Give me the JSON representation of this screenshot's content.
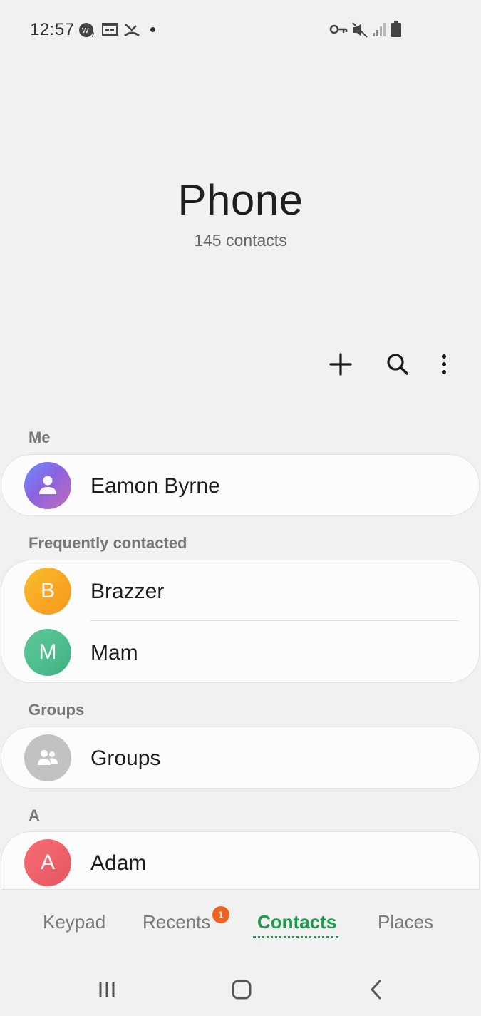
{
  "status_bar": {
    "time": "12:57"
  },
  "header": {
    "title": "Phone",
    "subtitle": "145 contacts"
  },
  "actions": {
    "add_icon": "plus-icon",
    "search_icon": "search-icon",
    "more_icon": "more-vert-icon"
  },
  "sections": {
    "me_label": "Me",
    "me_contact": {
      "name": "Eamon Byrne"
    },
    "frequent_label": "Frequently contacted",
    "frequent_contacts": [
      {
        "initial": "B",
        "name": "Brazzer",
        "color": "#f9a825"
      },
      {
        "initial": "M",
        "name": "Mam",
        "color": "#4fbf8f"
      }
    ],
    "groups_label": "Groups",
    "groups_item": {
      "name": "Groups"
    },
    "a_label": "A",
    "a_contacts": [
      {
        "initial": "A",
        "name": "Adam",
        "color": "#f0626a"
      }
    ]
  },
  "bottom_nav": {
    "tabs": [
      {
        "label": "Keypad"
      },
      {
        "label": "Recents"
      },
      {
        "label": "Contacts"
      },
      {
        "label": "Places"
      }
    ],
    "recents_badge": "1",
    "active_color": "#1b9b4b"
  }
}
